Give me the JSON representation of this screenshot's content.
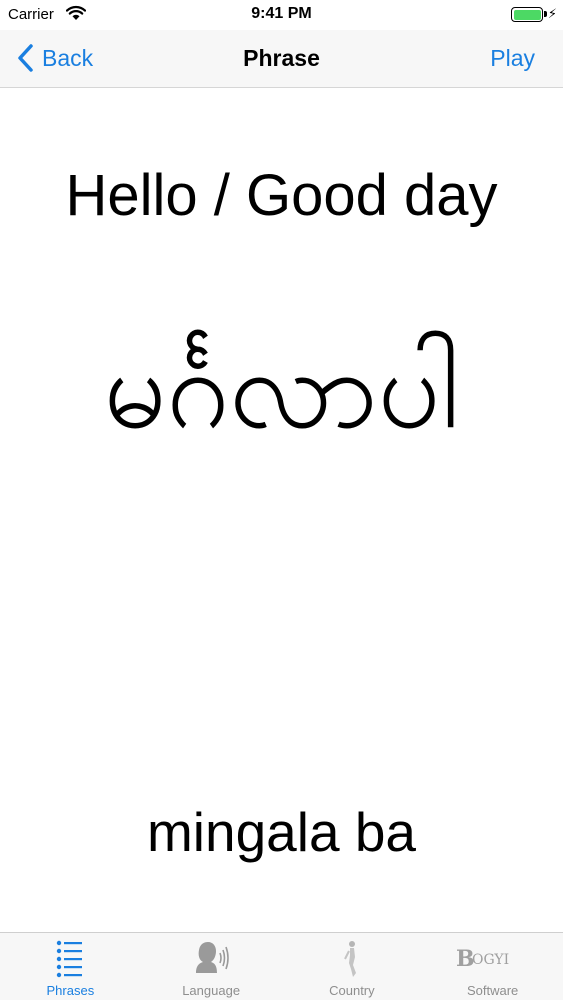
{
  "status_bar": {
    "carrier": "Carrier",
    "time": "9:41 PM",
    "battery_level": 1.0,
    "charging_icon": "bolt-icon"
  },
  "nav": {
    "back_label": "Back",
    "title": "Phrase",
    "play_label": "Play"
  },
  "phrase": {
    "english": "Hello / Good day",
    "myanmar": "မင်္ဂလာပါ",
    "romanization": "mingala ba"
  },
  "tabs": [
    {
      "label": "Phrases",
      "icon": "list-icon",
      "active": true
    },
    {
      "label": "Language",
      "icon": "speaking-head-icon",
      "active": false
    },
    {
      "label": "Country",
      "icon": "figure-icon",
      "active": false
    },
    {
      "label": "Software",
      "icon": "bogyi-logo-icon",
      "active": false
    }
  ],
  "colors": {
    "accent": "#1a7fe0",
    "battery": "#4cd964",
    "inactive_tab": "#8e8e8e"
  }
}
